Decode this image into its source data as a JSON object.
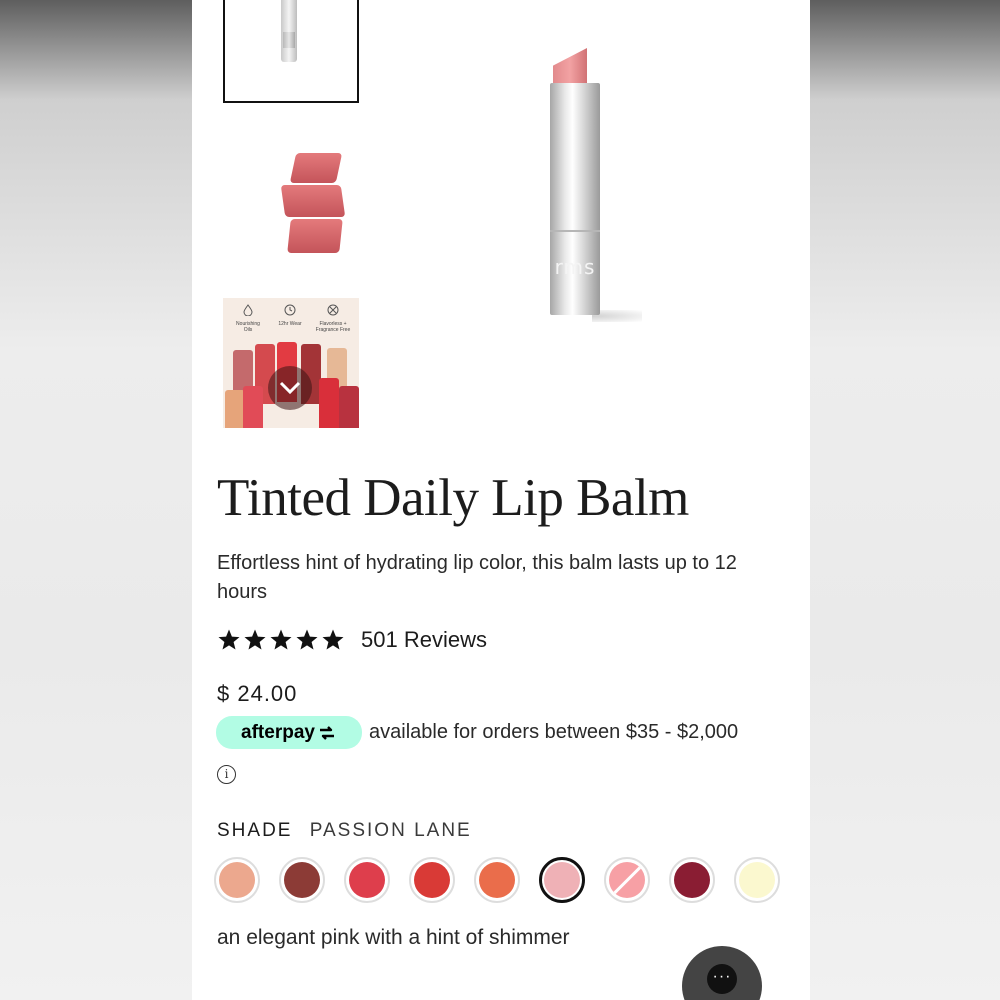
{
  "product": {
    "title": "Tinted Daily Lip Balm",
    "description": "Effortless hint of hydrating lip color, this balm lasts up to 12 hours",
    "rating": 5,
    "reviews_label": "501 Reviews",
    "price": "$ 24.00",
    "main_image_logo": "rms"
  },
  "gallery": {
    "features": [
      {
        "icon": "droplet-icon",
        "label": "Nourishing Oils"
      },
      {
        "icon": "clock-icon",
        "label": "12hr Wear"
      },
      {
        "icon": "no-fragrance-icon",
        "label": "Flavorless + Fragrance Free"
      }
    ],
    "more_icon": "chevron-down-icon"
  },
  "afterpay": {
    "badge_label": "afterpay",
    "text": "available for orders between $35 - $2,000",
    "badge_color": "#b2fce4"
  },
  "info_glyph": "i",
  "shade": {
    "label": "SHADE",
    "selected_name": "PASSION LANE",
    "description": "an elegant pink with a hint of shimmer",
    "swatches": [
      {
        "color": "#eca88e",
        "selected": false,
        "slashed": false
      },
      {
        "color": "#8c3b36",
        "selected": false,
        "slashed": false
      },
      {
        "color": "#de3e4c",
        "selected": false,
        "slashed": false
      },
      {
        "color": "#d93a36",
        "selected": false,
        "slashed": false
      },
      {
        "color": "#ea6d4b",
        "selected": false,
        "slashed": false
      },
      {
        "color": "#efb1b6",
        "selected": true,
        "slashed": false
      },
      {
        "color": "#f7a0a5",
        "selected": false,
        "slashed": true
      },
      {
        "color": "#8a1d33",
        "selected": false,
        "slashed": false
      },
      {
        "color": "#fbf8cf",
        "selected": false,
        "slashed": false
      }
    ]
  },
  "chat_button": {
    "glyph": "···",
    "icon": "ellipsis-icon"
  }
}
